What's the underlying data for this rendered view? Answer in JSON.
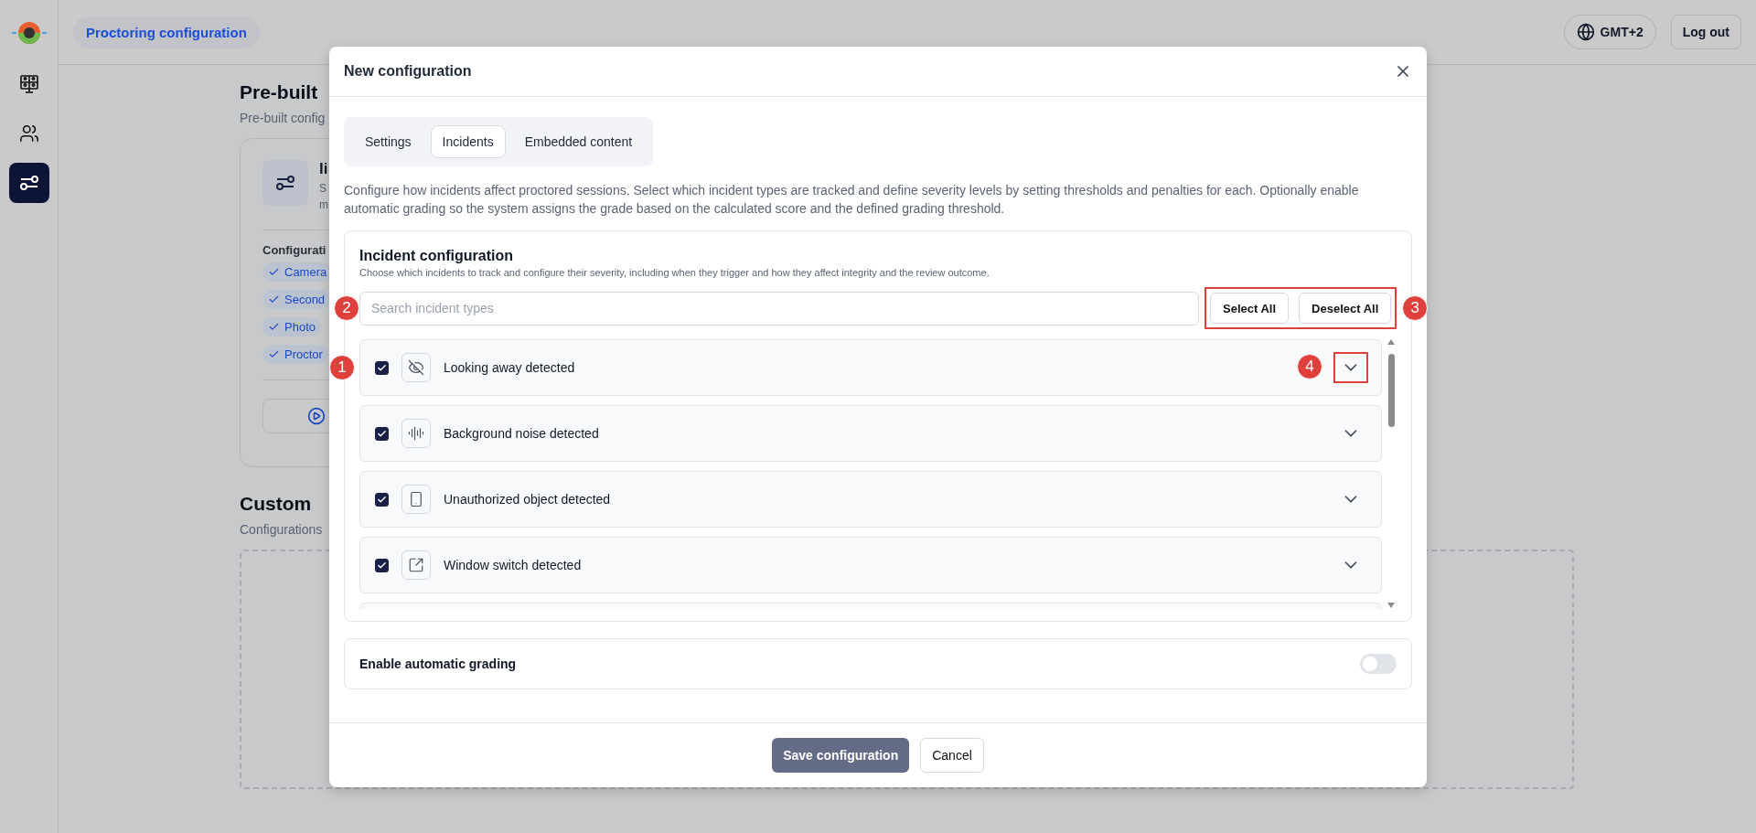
{
  "sidebar": {
    "items": [
      {
        "selected": false
      },
      {
        "selected": false
      },
      {
        "selected": true
      }
    ]
  },
  "header": {
    "breadcrumb": "Proctoring configuration",
    "timezone": "GMT+2",
    "logout": "Log out"
  },
  "background": {
    "prebuilt_title": "Pre-built",
    "prebuilt_subtitle": "Pre-built config",
    "card_title": "li",
    "card_desc": [
      "S",
      "m"
    ],
    "config_label": "Configurati",
    "chips": [
      "Camera",
      "Second",
      "Photo",
      "Proctor"
    ],
    "custom_title": "Custom",
    "custom_subtitle": "Configurations"
  },
  "modal": {
    "title": "New configuration",
    "tabs": [
      {
        "label": "Settings",
        "selected": false
      },
      {
        "label": "Incidents",
        "selected": true
      },
      {
        "label": "Embedded content",
        "selected": false
      }
    ],
    "description": "Configure how incidents affect proctored sessions. Select which incident types are tracked and define severity levels by setting thresholds and penalties for each. Optionally enable automatic grading so the system assigns the grade based on the calculated score and the defined grading threshold.",
    "incident_config": {
      "title": "Incident configuration",
      "subtitle": "Choose which incidents to track and configure their severity, including when they trigger and how they affect integrity and the review outcome.",
      "search": {
        "placeholder": "Search incident types",
        "marker": "2"
      },
      "bulk_actions": {
        "buttons": [
          "Select All",
          "Deselect All"
        ],
        "highlighted": true,
        "marker": "3"
      },
      "incidents": [
        {
          "name": "Looking away detected",
          "checked": true,
          "marker": "1",
          "chevron_highlighted": true,
          "chevron_marker": "4"
        },
        {
          "name": "Background noise detected",
          "checked": true,
          "chevron_highlighted": false
        },
        {
          "name": "Unauthorized object detected",
          "checked": true,
          "chevron_highlighted": false
        },
        {
          "name": "Window switch detected",
          "checked": true,
          "chevron_highlighted": false
        }
      ]
    },
    "auto_grading": {
      "label": "Enable automatic grading",
      "on": false
    },
    "buttons": {
      "save": "Save configuration",
      "cancel": "Cancel"
    }
  }
}
